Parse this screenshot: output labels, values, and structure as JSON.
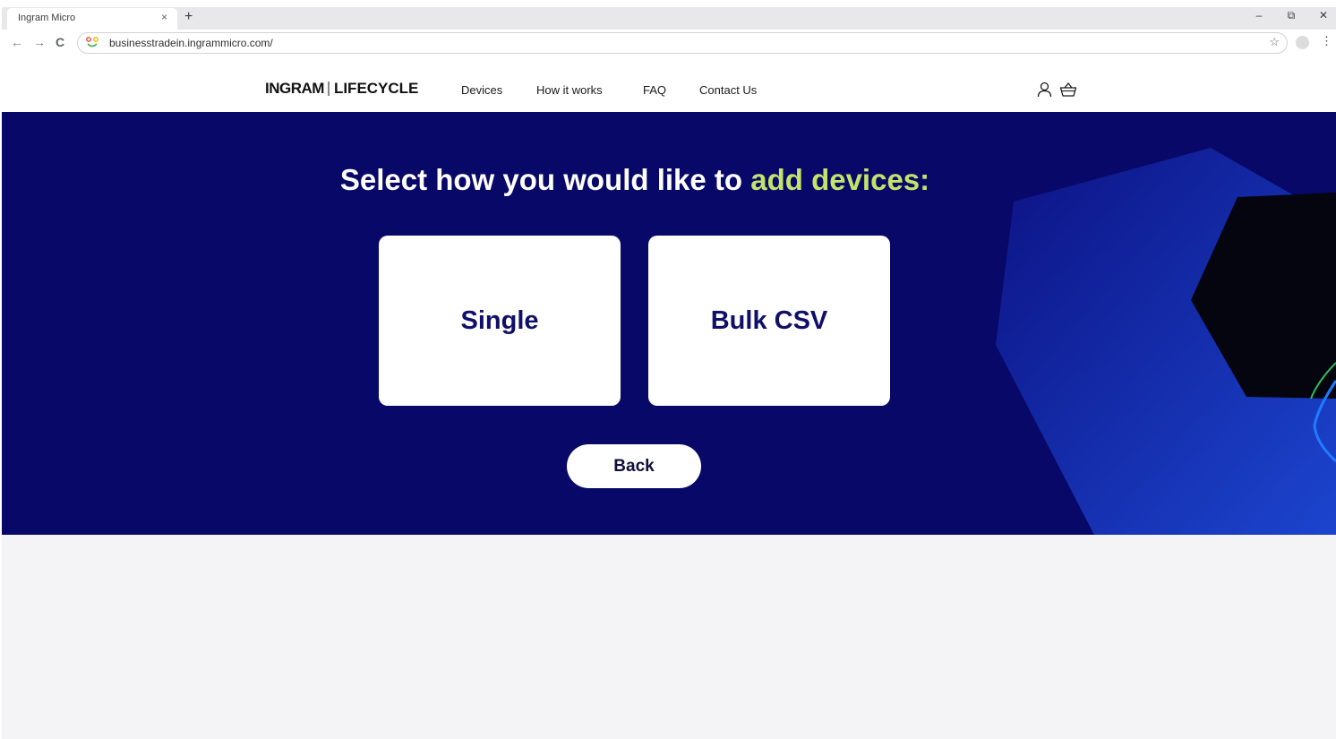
{
  "browser": {
    "tab_title": "Ingram Micro",
    "tab_close": "×",
    "new_tab": "+",
    "url": "businesstradein.ingrammicro.com/",
    "back": "←",
    "forward": "→",
    "reload": "C",
    "bookmark": "☆",
    "menu": "⋮",
    "window_controls": {
      "minimize": "–",
      "restore": "⧉",
      "close": "✕"
    }
  },
  "header": {
    "logo_ingram": "INGRAM",
    "logo_lifecycle": "LIFECYCLE",
    "nav": [
      "Devices",
      "How it works",
      "FAQ",
      "Contact Us"
    ]
  },
  "hero": {
    "title_main": "Select how you would like to ",
    "title_accent": "add devices:",
    "accent_color": "#c4e36a",
    "background_color": "#080868",
    "options": [
      "Single",
      "Bulk CSV"
    ],
    "back_label": "Back"
  }
}
